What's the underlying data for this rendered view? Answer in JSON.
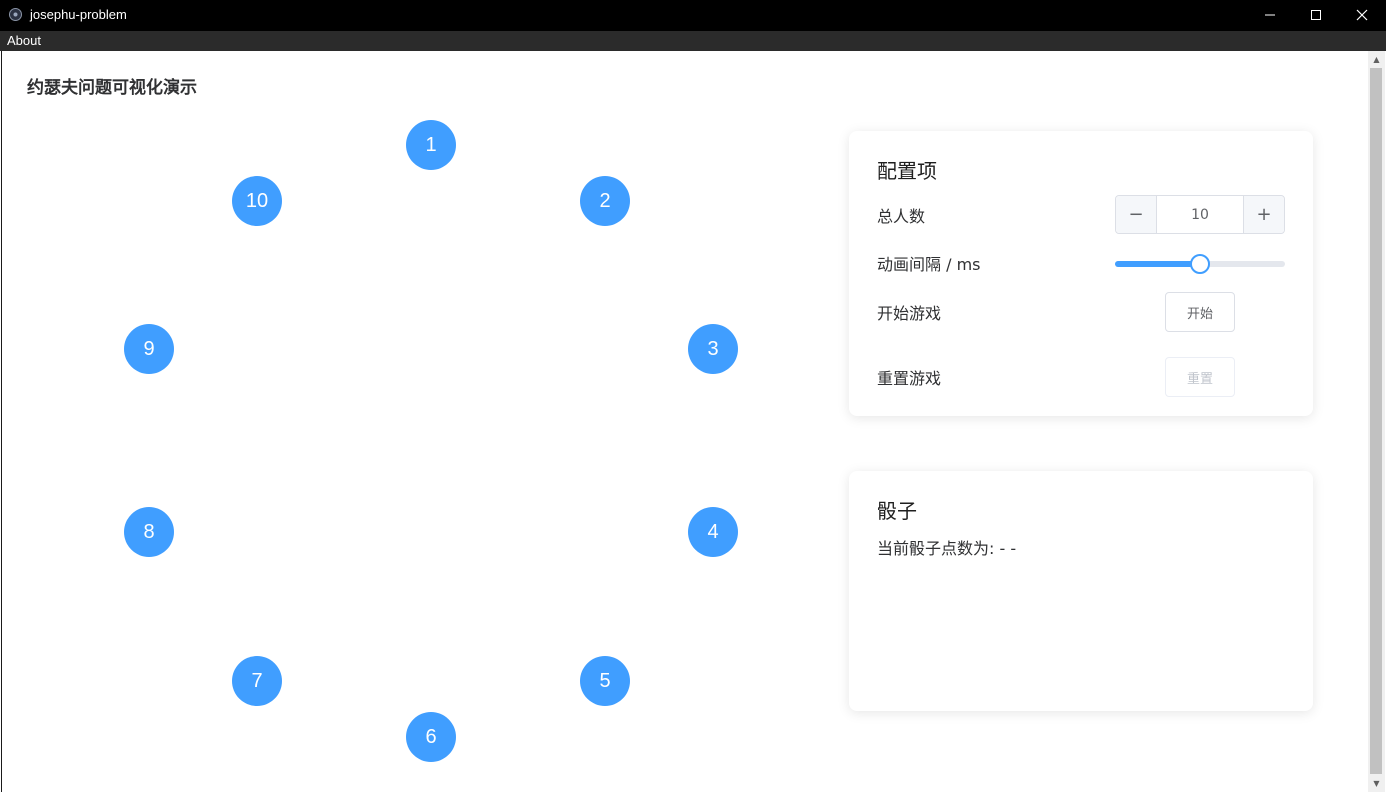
{
  "window": {
    "title": "josephu-problem"
  },
  "menu": {
    "about": "About"
  },
  "page": {
    "title": "约瑟夫问题可视化演示"
  },
  "circle": {
    "nodes": [
      {
        "label": "1"
      },
      {
        "label": "2"
      },
      {
        "label": "3"
      },
      {
        "label": "4"
      },
      {
        "label": "5"
      },
      {
        "label": "6"
      },
      {
        "label": "7"
      },
      {
        "label": "8"
      },
      {
        "label": "9"
      },
      {
        "label": "10"
      }
    ],
    "node_color": "#409eff"
  },
  "config": {
    "title": "配置项",
    "total_label": "总人数",
    "total_value": "10",
    "interval_label": "动画间隔 / ms",
    "interval_fraction": 0.5,
    "start_label": "开始游戏",
    "start_button": "开始",
    "reset_label": "重置游戏",
    "reset_button": "重置"
  },
  "dice": {
    "title": "骰子",
    "current_text": "当前骰子点数为: - -"
  },
  "colors": {
    "accent": "#409eff",
    "titlebar": "#000000",
    "menubar": "#2b2b2b"
  }
}
